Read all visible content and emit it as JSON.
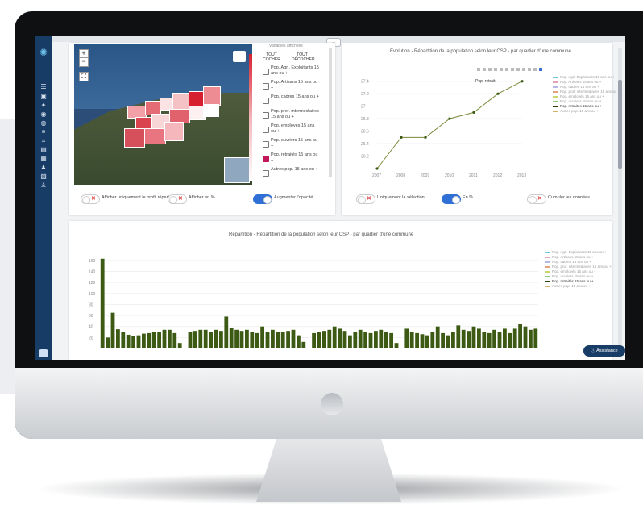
{
  "map_panel": {
    "variables_header": "Variables affichées",
    "select_all": "TOUT\nCOCHER",
    "deselect_all": "TOUT\nDÉCOCHER",
    "variables": [
      {
        "label": "Pop. Agri. Exploitants 15 ans ou +",
        "checked": false
      },
      {
        "label": "Pop. Artisans 15 ans ou +",
        "checked": false
      },
      {
        "label": "Pop. cadres 15 ans ou +",
        "checked": false
      },
      {
        "label": "Pop. prof. intermédiaires 15 ans ou +",
        "checked": false
      },
      {
        "label": "Pop. employés 15 ans ou +",
        "checked": false
      },
      {
        "label": "Pop. ouvriers 15 ans ou +",
        "checked": false
      },
      {
        "label": "Pop. retraités 15 ans ou +",
        "checked": true
      },
      {
        "label": "Autres pop. 15 ans ou +",
        "checked": false
      }
    ],
    "toggles": [
      {
        "label": "Afficher uniquement le profil répertorié",
        "on": false
      },
      {
        "label": "Afficher en %",
        "on": false
      },
      {
        "label": "Augmenter l'opacité",
        "on": true
      }
    ]
  },
  "line_panel": {
    "title": "Evolution - Répartition de la population selon leur CSP - par quartier d'une commune",
    "tooltip": "Pop. retrait.",
    "toggles": [
      {
        "label": "Uniquement la sélection",
        "on": false
      },
      {
        "label": "En %",
        "on": true
      },
      {
        "label": "Cumuler les données",
        "on": false
      }
    ],
    "legend": [
      "Pop. Agri. Exploitants 15 ans ou +",
      "Pop. Artisans 15 ans ou +",
      "Pop. cadres 15 ans ou +",
      "Pop. prof. intermédiaires 15 ans ou +",
      "Pop. employés 15 ans ou +",
      "Pop. ouvriers 15 ans ou +",
      "Pop. retraités 15 ans ou +",
      "Autres pop. 15 ans ou +"
    ]
  },
  "bar_panel": {
    "title": "Répartition - Répartition de la population selon leur CSP - par quartier d'une commune",
    "legend": [
      "Pop. Agri. Exploitants 15 ans ou +",
      "Pop. Artisans 15 ans ou +",
      "Pop. cadres 15 ans ou +",
      "Pop. prof. intermédiaires 15 ans ou +",
      "Pop. employés 15 ans ou +",
      "Pop. ouvriers 15 ans ou +",
      "Pop. retraités 15 ans ou +",
      "Autres pop. 15 ans ou +"
    ]
  },
  "assistance_label": "Assistance",
  "colors": {
    "sidebar": "#173c66",
    "accent": "#2f6fd6",
    "series_main": "#3c5a14",
    "map_max": "#d62030"
  },
  "chart_data": [
    {
      "type": "line",
      "title": "Evolution - Répartition de la population selon leur CSP - par quartier d'une commune",
      "x": [
        "2007",
        "2008",
        "2009",
        "2010",
        "2011",
        "2012",
        "2013"
      ],
      "series": [
        {
          "name": "Pop. retraités 15 ans ou +",
          "values": [
            26.0,
            26.5,
            26.5,
            26.8,
            26.9,
            27.2,
            27.4
          ]
        }
      ],
      "yticks": [
        "26.2",
        "26.4",
        "26.6",
        "26.8",
        "27",
        "27.2",
        "27.4"
      ],
      "ylim": [
        26.0,
        27.5
      ]
    },
    {
      "type": "bar",
      "title": "Répartition - Répartition de la population selon leur CSP - par quartier d'une commune",
      "yticks": [
        "20",
        "40",
        "60",
        "80",
        "100",
        "120",
        "140",
        "160"
      ],
      "ylim": [
        0,
        170
      ],
      "series": [
        {
          "name": "Pop. retraités 15 ans ou +",
          "values": [
            163,
            20,
            65,
            35,
            30,
            25,
            22,
            24,
            27,
            28,
            30,
            30,
            34,
            34,
            28,
            10,
            0,
            30,
            32,
            34,
            34,
            30,
            34,
            32,
            58,
            38,
            34,
            32,
            34,
            30,
            28,
            40,
            30,
            34,
            30,
            30,
            32,
            34,
            24,
            12,
            0,
            28,
            30,
            32,
            34,
            40,
            36,
            32,
            24,
            30,
            34,
            30,
            28,
            32,
            34,
            30,
            28,
            10,
            0,
            36,
            30,
            28,
            26,
            24,
            30,
            40,
            28,
            24,
            30,
            42,
            34,
            32,
            40,
            36,
            30,
            28,
            34,
            30,
            36,
            28,
            36,
            44,
            40,
            34,
            36
          ]
        }
      ]
    }
  ]
}
